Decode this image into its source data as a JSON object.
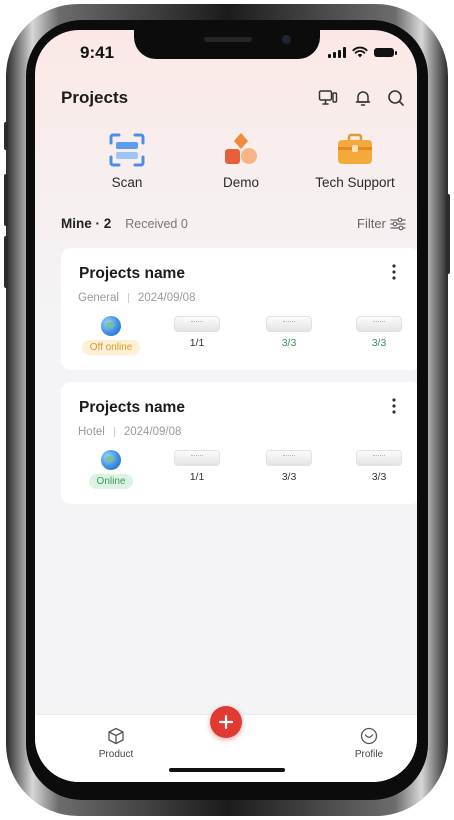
{
  "status_bar": {
    "time": "9:41"
  },
  "header": {
    "title": "Projects"
  },
  "quick_actions": [
    {
      "label": "Scan",
      "icon": "scan-icon"
    },
    {
      "label": "Demo",
      "icon": "demo-icon"
    },
    {
      "label": "Tech Support",
      "icon": "toolbox-icon"
    }
  ],
  "tabs": {
    "mine": "Mine · 2",
    "received": "Received 0"
  },
  "filter_label": "Filter",
  "projects": [
    {
      "name": "Projects name",
      "type": "General",
      "date": "2024/09/08",
      "status": "Off online",
      "counts": [
        "1/1",
        "3/3",
        "3/3"
      ]
    },
    {
      "name": "Projects name",
      "type": "Hotel",
      "date": "2024/09/08",
      "status": "Online",
      "counts": [
        "1/1",
        "3/3",
        "3/3"
      ]
    }
  ],
  "bottom_nav": {
    "product": "Product",
    "profile": "Profile"
  },
  "colors": {
    "accent": "#e03a33",
    "online": "#3c9a5c",
    "offline": "#d99b2a"
  }
}
